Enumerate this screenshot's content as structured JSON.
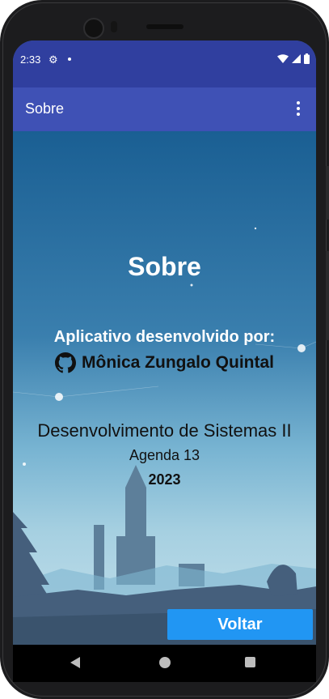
{
  "status_bar": {
    "time": "2:33",
    "icons": [
      "gear-icon",
      "notification-dot-icon",
      "wifi-icon",
      "signal-icon",
      "battery-icon"
    ]
  },
  "app_bar": {
    "title": "Sobre",
    "menu_icon": "overflow-menu-icon"
  },
  "content": {
    "heading": "Sobre",
    "developed_by": "Aplicativo desenvolvido por:",
    "author_icon": "github-icon",
    "author": "Mônica Zungalo Quintal",
    "course": "Desenvolvimento de Sistemas II",
    "agenda": "Agenda 13",
    "year": "2023"
  },
  "actions": {
    "back_button": "Voltar"
  },
  "nav_bar": {
    "icons": [
      "back-icon",
      "home-icon",
      "recents-icon"
    ]
  },
  "colors": {
    "status_bar": "#303f9f",
    "app_bar": "#3f51b5",
    "button": "#2196f3"
  }
}
